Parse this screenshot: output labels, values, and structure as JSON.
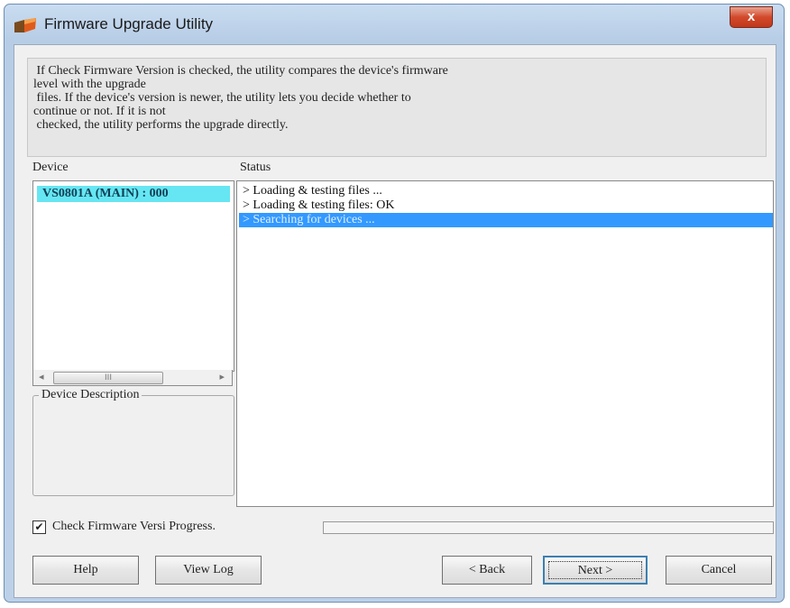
{
  "window": {
    "title": "Firmware Upgrade Utility",
    "close_glyph": "x"
  },
  "info_text": " If Check Firmware Version is checked, the utility compares the device's firmware\nlevel with the upgrade\n files. If the device's version is newer, the utility lets you decide whether to\ncontinue or not. If it is not\n checked, the utility performs the upgrade directly.",
  "device_label": "Device",
  "status_label": "Status",
  "devices": [
    "VS0801A (MAIN) : 000"
  ],
  "scroll": {
    "left": "◂",
    "right": "▸",
    "thumb": "III"
  },
  "device_description_label": "Device Description",
  "status_lines": [
    {
      "text": "> Loading & testing files ...",
      "selected": false
    },
    {
      "text": "> Loading & testing files: OK",
      "selected": false
    },
    {
      "text": "> Searching for devices ...",
      "selected": true
    }
  ],
  "check_firmware": {
    "checked": true,
    "mark": "✔",
    "label": "Check Firmware Versi"
  },
  "progress_label": "Progress.",
  "progress_value": 0,
  "buttons": {
    "help": "Help",
    "view_log": "View Log",
    "back": "< Back",
    "next": "Next >",
    "cancel": "Cancel"
  }
}
